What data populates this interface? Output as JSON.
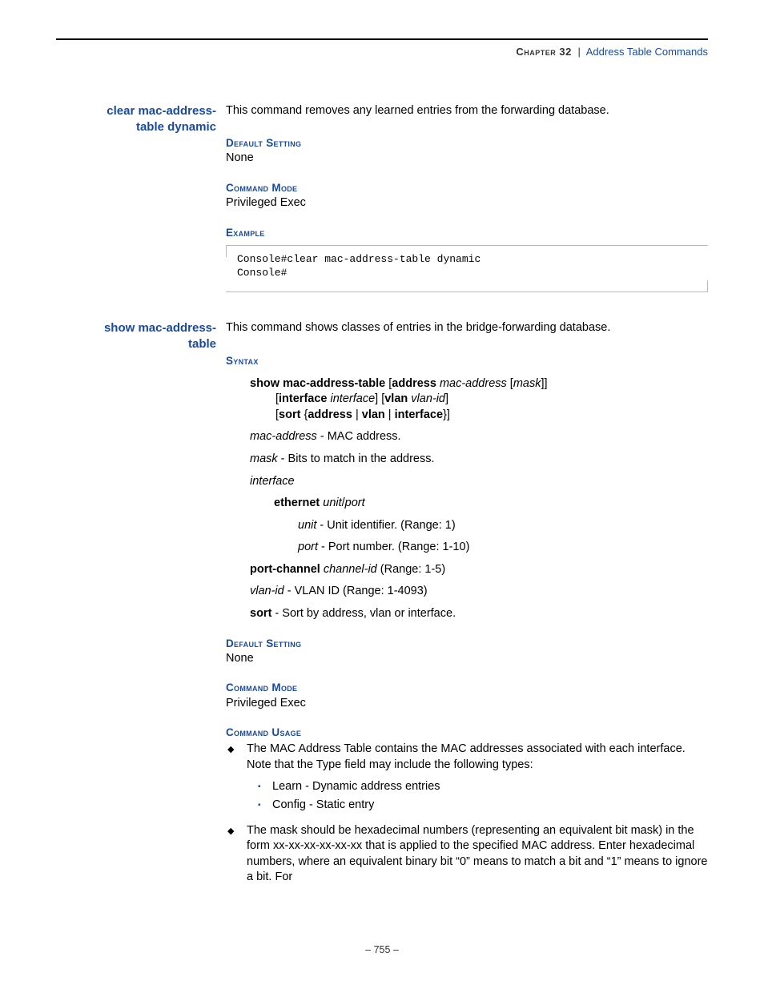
{
  "header": {
    "chapter": "Chapter 32",
    "sep": "|",
    "title": "Address Table Commands"
  },
  "cmd1": {
    "name_l1": "clear mac-address-",
    "name_l2": "table dynamic",
    "desc": "This command removes any learned entries from the forwarding database.",
    "default_head": "Default Setting",
    "default_body": "None",
    "mode_head": "Command Mode",
    "mode_body": "Privileged Exec",
    "example_head": "Example",
    "example_code": "Console#clear mac-address-table dynamic\nConsole#"
  },
  "cmd2": {
    "name_l1": "show mac-address-",
    "name_l2": "table",
    "desc": "This command shows classes of entries in the bridge-forwarding database.",
    "syntax_head": "Syntax",
    "syn": {
      "show": "show mac-address-table",
      "address": "address",
      "macaddr": "mac-address",
      "mask": "mask",
      "interface_kw": "interface",
      "interface_it": "interface",
      "vlan_kw": "vlan",
      "vlanid": "vlan-id",
      "sort_kw": "sort",
      "addr_kw": "address",
      "vlan_kw2": "vlan",
      "iface_kw2": "interface"
    },
    "params": {
      "mac_l": "mac-address",
      "mac_d": " - MAC address.",
      "mask_l": "mask",
      "mask_d": " - Bits to match in the address.",
      "iface_l": "interface",
      "eth_kw": "ethernet",
      "eth_arg": "unit",
      "eth_sep": "/",
      "eth_arg2": "port",
      "unit_l": "unit",
      "unit_d": " - Unit identifier. (Range: 1)",
      "port_l": "port",
      "port_d": " - Port number. (Range: 1-10)",
      "pc_kw": "port-channel",
      "pc_arg": "channel-id",
      "pc_d": " (Range: 1-5)",
      "vlan_l": "vlan-id",
      "vlan_d": " - VLAN ID (Range: 1-4093)",
      "sort_l": "sort",
      "sort_d": " - Sort by address, vlan or interface."
    },
    "default_head": "Default Setting",
    "default_body": "None",
    "mode_head": "Command Mode",
    "mode_body": "Privileged Exec",
    "usage_head": "Command Usage",
    "usage1": "The MAC Address Table contains the MAC addresses associated with each interface. Note that the Type field may include the following types:",
    "usage1a": "Learn - Dynamic address entries",
    "usage1b": "Config - Static entry",
    "usage2": "The mask should be hexadecimal numbers (representing an equivalent bit mask) in the form xx-xx-xx-xx-xx-xx that is applied to the specified MAC address. Enter hexadecimal numbers, where an equivalent binary bit “0” means to match a bit and “1” means to ignore a bit. For"
  },
  "footer": {
    "page": "–  755  –"
  }
}
